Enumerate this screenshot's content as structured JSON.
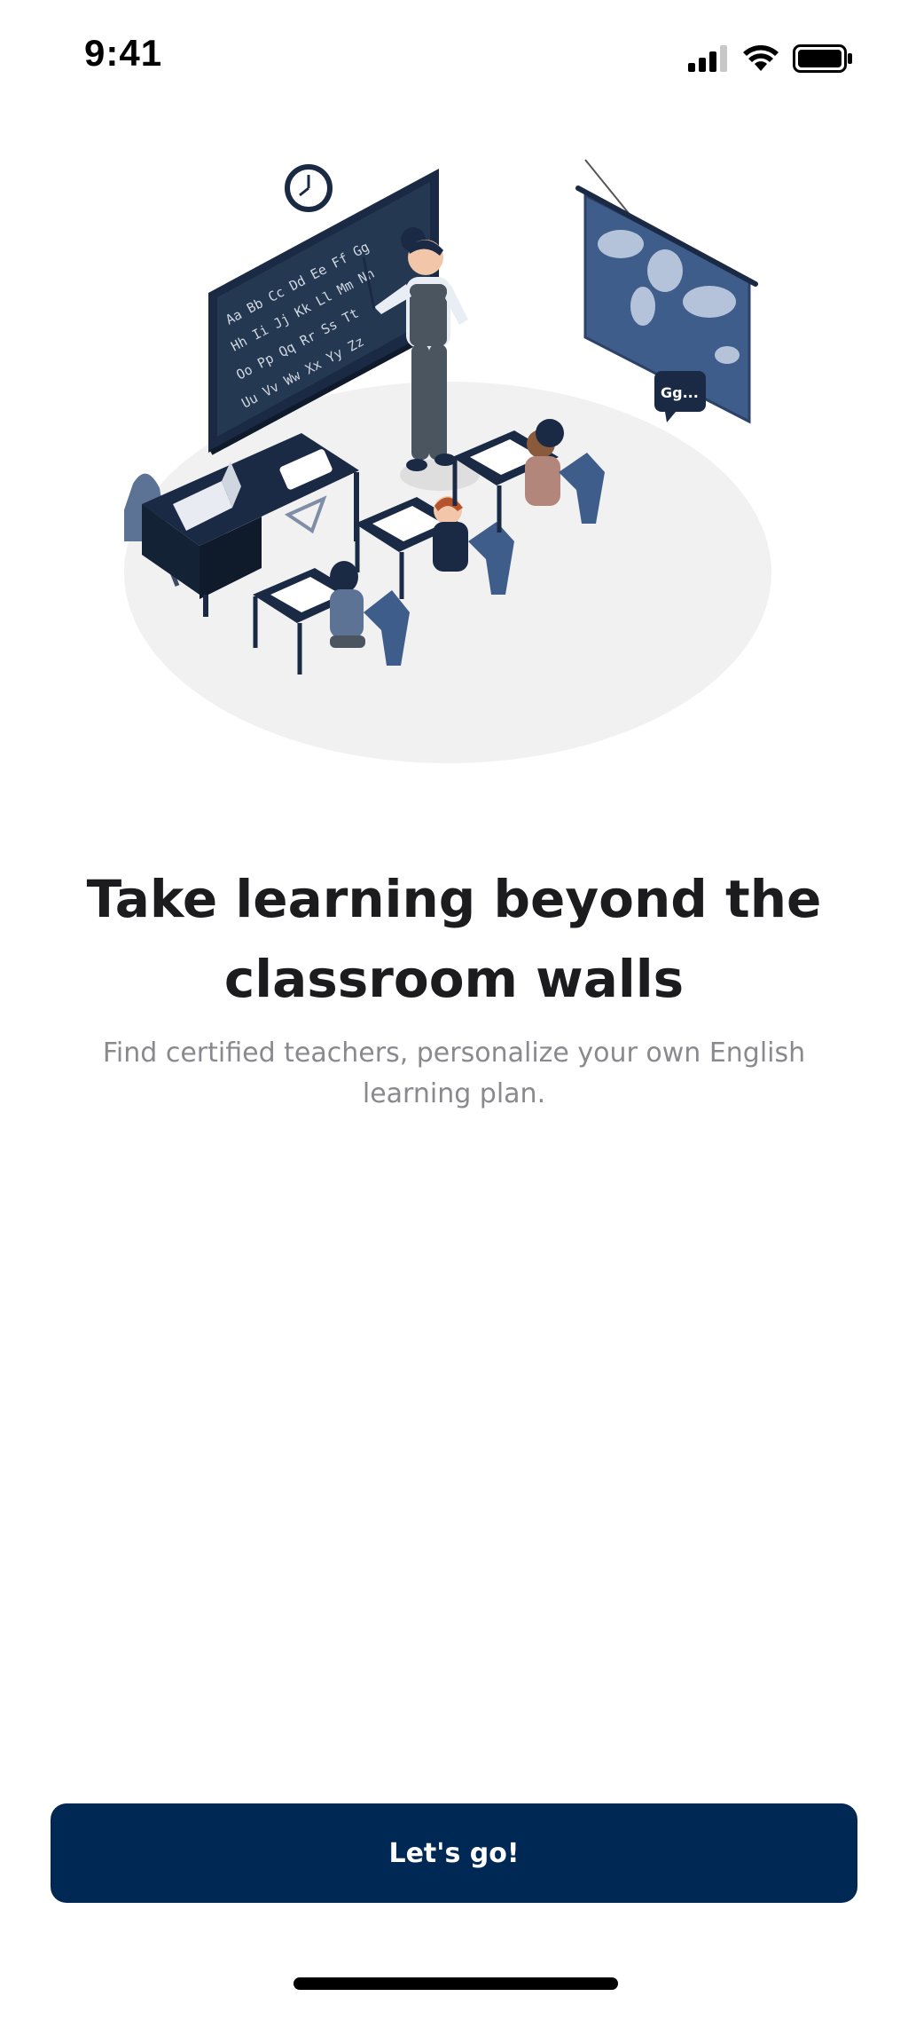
{
  "status_bar": {
    "time": "9:41",
    "icons": [
      "signal-icon",
      "wifi-icon",
      "battery-icon"
    ]
  },
  "illustration": {
    "subject": "classroom-illustration",
    "blackboard_text": [
      "Aa Bb Cc Dd Ee Ff Gg",
      "Hh Ii Jj Kk Ll Mm Nn",
      "Oo Pp Qq Rr Ss Tt",
      "Uu Vv Ww Xx Yy Zz"
    ],
    "speech_bubble": "Gg..."
  },
  "onboarding": {
    "title": "Take learning beyond the classroom walls",
    "subtitle": "Find certified teachers, personalize your own English learning plan.",
    "cta_label": "Let's go!"
  },
  "colors": {
    "primary": "#002855",
    "title": "#1c1c1e",
    "subtitle": "#8a8a8e",
    "background": "#ffffff"
  }
}
